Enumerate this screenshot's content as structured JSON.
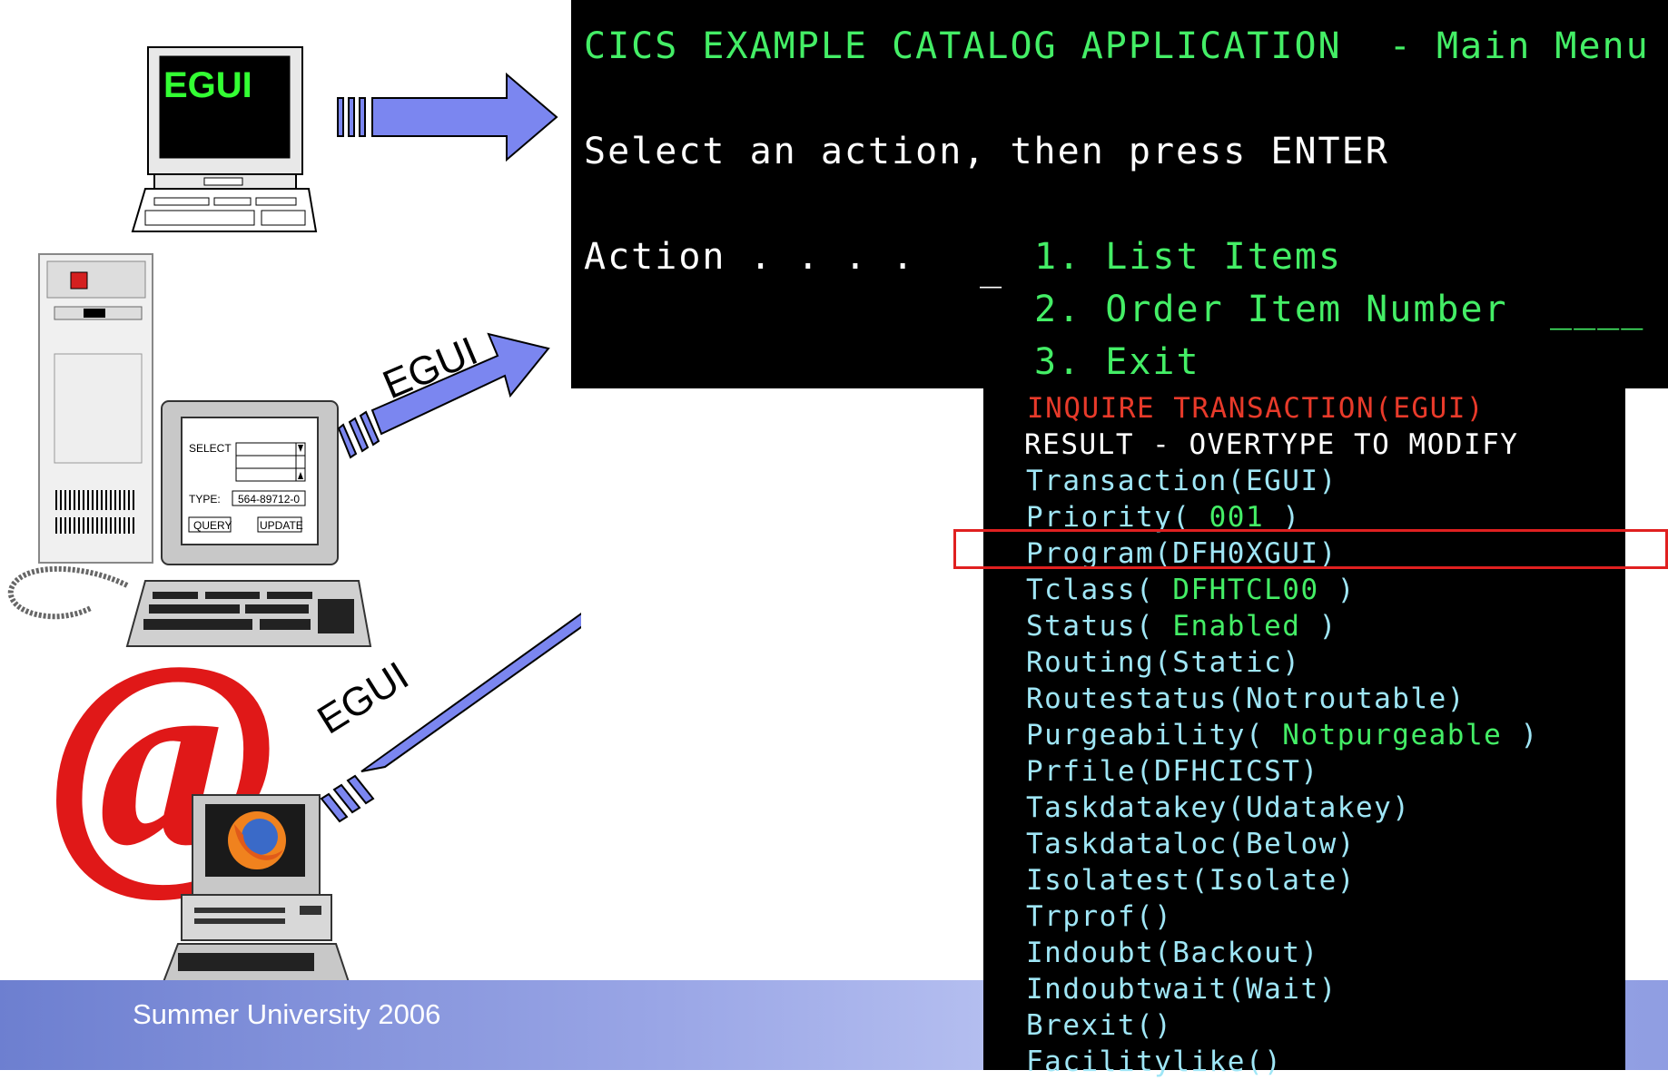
{
  "footer": {
    "text": "Summer University 2006"
  },
  "top_terminal": {
    "label": "EGUI",
    "screen_color": "#000000",
    "text_color": "#33ff33"
  },
  "server_terminal": {
    "arrow_label": "EGUI",
    "form": {
      "select_label": "SELECT",
      "type_label": "TYPE:",
      "type_value": "564-89712-0",
      "query_button": "QUERY",
      "update_button": "UPDATE"
    }
  },
  "web_terminal": {
    "arrow_label": "EGUI",
    "logo_letter": "e",
    "browser_icon": "firefox-icon"
  },
  "menu_screen": {
    "title": "CICS EXAMPLE CATALOG APPLICATION  - Main Menu",
    "prompt": "Select an action, then press ENTER",
    "action_label": "Action . . . .",
    "action_cursor": "_",
    "options": [
      "1. List Items",
      "2. Order Item Number",
      "3. Exit"
    ],
    "order_field": "____"
  },
  "inquire_screen": {
    "command": "INQUIRE TRANSACTION(EGUI)",
    "result_header": "RESULT - OVERTYPE TO MODIFY",
    "attributes": [
      {
        "name": "Transaction(EGUI)",
        "value": ""
      },
      {
        "name": "Priority(",
        "value": " 001 ",
        "close": ")"
      },
      {
        "name": "Program(DFH0XGUI)",
        "value": "",
        "highlight": true
      },
      {
        "name": "Tclass(",
        "value": " DFHTCL00 ",
        "close": ")"
      },
      {
        "name": "Status(",
        "value": " Enabled ",
        "close": ")"
      },
      {
        "name": "Routing(Static)",
        "value": ""
      },
      {
        "name": "Routestatus(Notroutable)",
        "value": ""
      },
      {
        "name": "Purgeability(",
        "value": " Notpurgeable ",
        "close": ")"
      },
      {
        "name": "Prfile(DFHCICST)",
        "value": ""
      },
      {
        "name": "Taskdatakey(Udatakey)",
        "value": ""
      },
      {
        "name": "Taskdataloc(Below)",
        "value": ""
      },
      {
        "name": "Isolatest(Isolate)",
        "value": ""
      },
      {
        "name": "Trprof()",
        "value": ""
      },
      {
        "name": "Indoubt(Backout)",
        "value": ""
      },
      {
        "name": "Indoubtwait(Wait)",
        "value": ""
      },
      {
        "name": "Brexit()",
        "value": ""
      },
      {
        "name": "Facilitylike()",
        "value": ""
      }
    ],
    "colors": {
      "command": "#e83a2a",
      "header": "#ffffff",
      "attr": "#9fe6f6",
      "value": "#44ee66",
      "highlight_box": "#e02020"
    }
  },
  "arrow_color": "#7b86f0"
}
